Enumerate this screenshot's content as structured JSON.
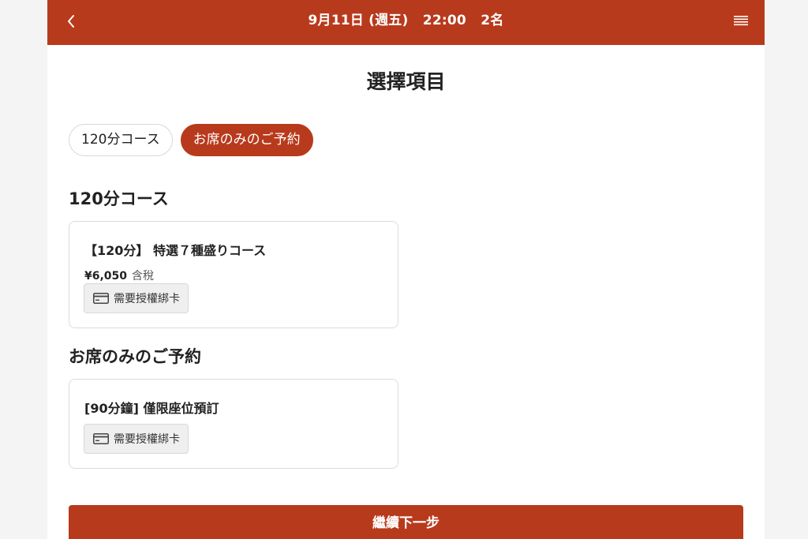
{
  "header": {
    "title": "9月11日 (週五)   22:00   2名",
    "back_icon": "chevron-left-icon",
    "menu_icon": "hamburger-menu-icon"
  },
  "page_title": "選擇項目",
  "tabs": [
    {
      "label": "120分コース",
      "active": false
    },
    {
      "label": "お席のみのご予約",
      "active": true
    }
  ],
  "sections": [
    {
      "heading": "120分コース",
      "items": [
        {
          "title": "【120分】 特選７種盛りコース",
          "price": "¥6,050",
          "tax_note": "含稅",
          "badge_icon": "credit-card-icon",
          "badge_label": "需要授權綁卡"
        }
      ]
    },
    {
      "heading": "お席のみのご予約",
      "items": [
        {
          "title": "[90分鐘] 僅限座位預訂",
          "badge_icon": "credit-card-icon",
          "badge_label": "需要授權綁卡"
        }
      ]
    }
  ],
  "continue_button": "繼續下一步",
  "colors": {
    "brand": "#b83a1c",
    "card_border": "#dcdcdc",
    "badge_bg": "#efefef"
  }
}
